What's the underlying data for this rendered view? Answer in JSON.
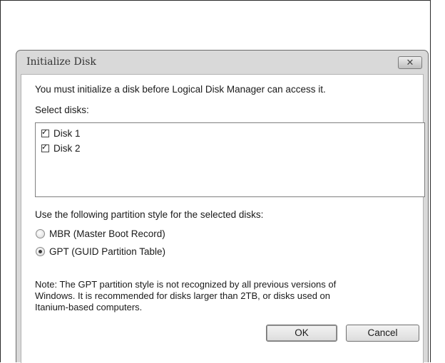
{
  "dialog": {
    "title": "Initialize Disk",
    "close_label": "✕",
    "intro": "You must initialize a disk before Logical Disk Manager can access it.",
    "select_label": "Select disks:",
    "disks": [
      {
        "label": "Disk 1",
        "checked": true
      },
      {
        "label": "Disk 2",
        "checked": true
      }
    ],
    "partition_label": "Use the following partition style for the selected disks:",
    "options": [
      {
        "label": "MBR (Master Boot Record)",
        "selected": false
      },
      {
        "label": "GPT (GUID Partition Table)",
        "selected": true
      }
    ],
    "note_lines": [
      "Note: The GPT partition style is not recognized by all previous versions of",
      "Windows. It is recommended for disks larger than 2TB, or disks used on",
      "Itanium-based computers."
    ],
    "ok_label": "OK",
    "cancel_label": "Cancel"
  }
}
